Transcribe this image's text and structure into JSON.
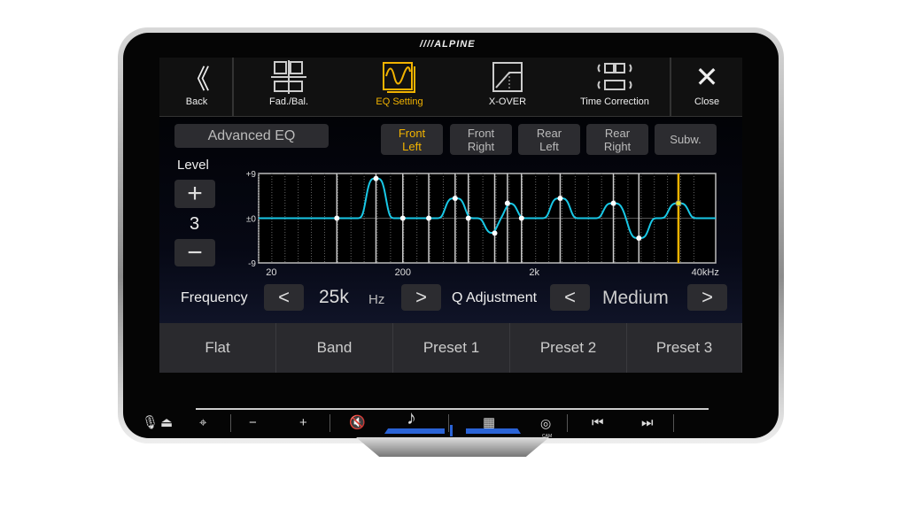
{
  "brand": "ALPINE",
  "topbar": {
    "items": [
      {
        "label": "Back",
        "icon": "double-chevron-left-icon"
      },
      {
        "label": "Fad./Bal.",
        "icon": "fader-balance-icon"
      },
      {
        "label": "EQ Setting",
        "icon": "eq-wave-icon",
        "active": true
      },
      {
        "label": "X-OVER",
        "icon": "crossover-icon"
      },
      {
        "label": "Time Correction",
        "icon": "time-correction-icon"
      },
      {
        "label": "Close",
        "icon": "close-icon"
      }
    ]
  },
  "mode_button": "Advanced EQ",
  "channels": [
    {
      "l1": "Front",
      "l2": "Left",
      "selected": true
    },
    {
      "l1": "Front",
      "l2": "Right"
    },
    {
      "l1": "Rear",
      "l2": "Left"
    },
    {
      "l1": "Rear",
      "l2": "Right"
    },
    {
      "l1": "Subw.",
      "l2": ""
    }
  ],
  "level": {
    "label": "Level",
    "value": "3",
    "plus": "+",
    "minus": "−"
  },
  "frequency": {
    "label": "Frequency",
    "value": "25k",
    "unit": "Hz"
  },
  "q": {
    "label": "Q Adjustment",
    "value": "Medium"
  },
  "presets": [
    "Flat",
    "Band",
    "Preset 1",
    "Preset 2",
    "Preset 3"
  ],
  "colors": {
    "accent": "#f2b300",
    "curve": "#19c8e6"
  },
  "chart_data": {
    "type": "line",
    "xscale": "log",
    "xlim": [
      16,
      48000
    ],
    "ylim": [
      -9,
      9
    ],
    "xticks": [
      {
        "v": 20,
        "label": "20"
      },
      {
        "v": 200,
        "label": "200"
      },
      {
        "v": 2000,
        "label": "2k"
      },
      {
        "v": 40000,
        "label": "40kHz"
      }
    ],
    "yticks": [
      {
        "v": 9,
        "label": "+9"
      },
      {
        "v": 0,
        "label": "±0"
      },
      {
        "v": -9,
        "label": "-9"
      }
    ],
    "bands": [
      {
        "f": 63,
        "g": 0
      },
      {
        "f": 125,
        "g": 8
      },
      {
        "f": 200,
        "g": 0
      },
      {
        "f": 315,
        "g": 0
      },
      {
        "f": 500,
        "g": 4
      },
      {
        "f": 630,
        "g": 0
      },
      {
        "f": 1000,
        "g": -3
      },
      {
        "f": 1250,
        "g": 3
      },
      {
        "f": 1600,
        "g": 0
      },
      {
        "f": 3150,
        "g": 4
      },
      {
        "f": 8000,
        "g": 3
      },
      {
        "f": 12500,
        "g": -4
      },
      {
        "f": 25000,
        "g": 3,
        "selected": true
      }
    ]
  },
  "hardware": {
    "buttons": [
      "voice-icon",
      "home-icon",
      "map-pin-icon",
      "volume-down-icon",
      "volume-up-icon",
      "mute-icon",
      "music-note-icon",
      "app-grid-icon",
      "camera-icon",
      "previous-track-icon",
      "next-track-icon"
    ],
    "cam_label": "CAM"
  }
}
